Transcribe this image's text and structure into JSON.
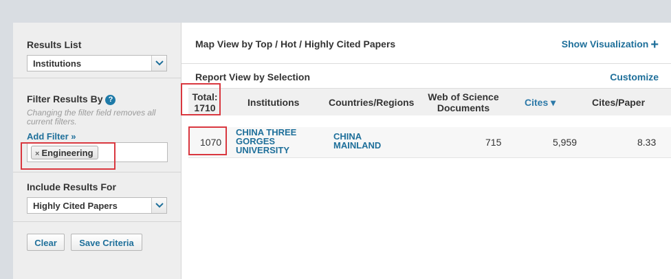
{
  "sidebar": {
    "results_list": {
      "label": "Results List",
      "selected": "Institutions"
    },
    "filter": {
      "label": "Filter Results By",
      "note": "Changing the filter field removes all current filters.",
      "add_filter": "Add Filter »",
      "tags": [
        {
          "label": "Engineering",
          "remove": "×"
        }
      ]
    },
    "include": {
      "label": "Include Results For",
      "selected": "Highly Cited Papers"
    },
    "buttons": {
      "clear": "Clear",
      "save_criteria": "Save Criteria"
    }
  },
  "main": {
    "map_view_title": "Map View by Top / Hot / Highly Cited Papers",
    "show_visualization": "Show Visualization",
    "show_visualization_icon": "+",
    "report_view_title": "Report View by Selection",
    "customize": "Customize",
    "table": {
      "headers": {
        "total_label": "Total:",
        "total_value": "1710",
        "institutions": "Institutions",
        "countries": "Countries/Regions",
        "wos_line1": "Web of Science",
        "wos_line2": "Documents",
        "cites": "Cites",
        "cites_sort_icon": "▾",
        "cites_per_paper": "Cites/Paper"
      },
      "rows": [
        {
          "rank": "1070",
          "institution_line1": "CHINA THREE",
          "institution_line2": "GORGES",
          "institution_line3": "UNIVERSITY",
          "country_line1": "CHINA",
          "country_line2": "MAINLAND",
          "wos_documents": "715",
          "cites": "5,959",
          "cites_per_paper": "8.33"
        }
      ]
    }
  },
  "colors": {
    "link": "#1e6f9a",
    "highlight": "#d9363e",
    "sidebar_bg": "#eeeeee"
  }
}
